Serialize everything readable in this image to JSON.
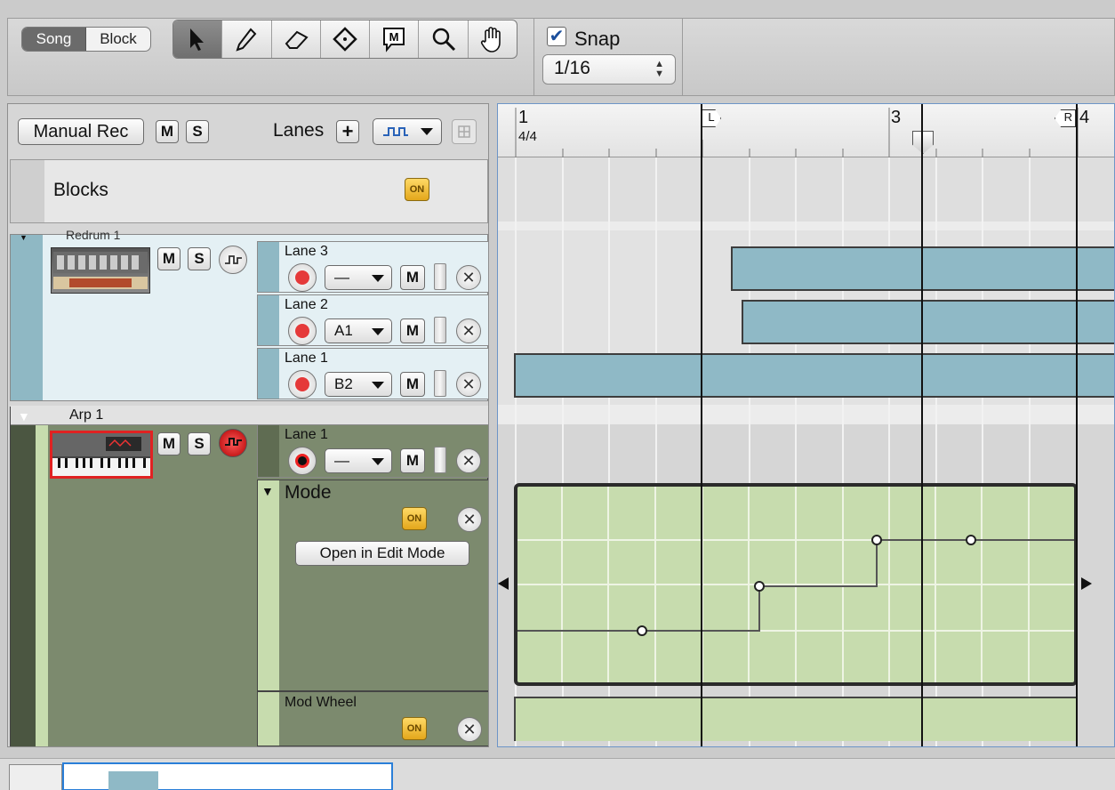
{
  "toolbar": {
    "song_label": "Song",
    "block_label": "Block",
    "tools": [
      "arrow-icon",
      "pencil-icon",
      "eraser-icon",
      "razor-icon",
      "mute-icon",
      "magnify-icon",
      "hand-icon"
    ],
    "snap_label": "Snap",
    "snap_checked": true,
    "snap_value": "1/16"
  },
  "track_header": {
    "manual_rec_label": "Manual Rec",
    "m_label": "M",
    "s_label": "S",
    "lanes_label": "Lanes",
    "plus_label": "+"
  },
  "blocks_row": {
    "label": "Blocks",
    "on_label": "ON"
  },
  "redrum_track": {
    "title": "Redrum 1",
    "m_label": "M",
    "s_label": "S",
    "lanes": [
      {
        "name": "Lane 3",
        "pattern": "—",
        "m_label": "M"
      },
      {
        "name": "Lane 2",
        "pattern": "A1",
        "m_label": "M"
      },
      {
        "name": "Lane 1",
        "pattern": "B2",
        "m_label": "M"
      }
    ]
  },
  "arp_track": {
    "title": "Arp 1",
    "m_label": "M",
    "s_label": "S",
    "lane": {
      "name": "Lane 1",
      "pattern": "—",
      "m_label": "M"
    },
    "mode": {
      "label": "Mode",
      "on_label": "ON",
      "open_button": "Open in Edit Mode"
    },
    "mod_wheel": {
      "label": "Mod Wheel",
      "on_label": "ON"
    }
  },
  "ruler": {
    "bar1": "1",
    "time_sig": "4/4",
    "bar3": "3",
    "bar4": "4",
    "left_loc": "L",
    "right_loc": "R"
  },
  "colors": {
    "clip_blue": "#8fb9c6",
    "automation_green": "#c7dcae",
    "arp_track_bg": "#7c8a6e",
    "on_button": "#e3a71b"
  }
}
